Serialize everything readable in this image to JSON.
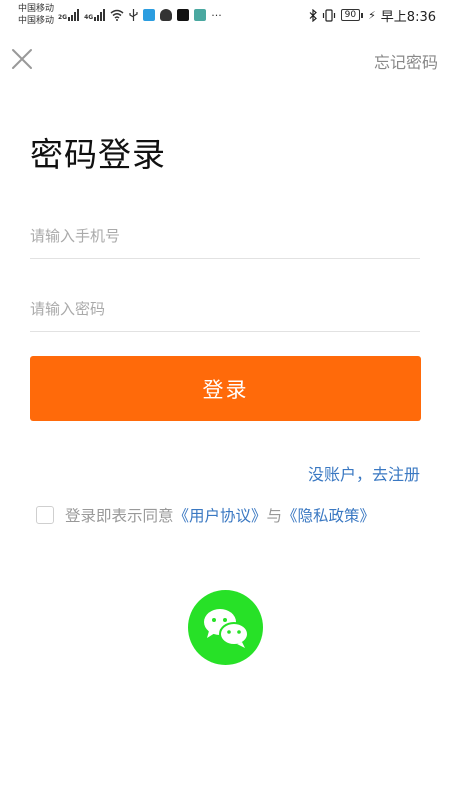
{
  "status_bar": {
    "carrier_1": "中国移动",
    "carrier_2": "中国移动",
    "net_1": "2G",
    "net_2": "4G",
    "battery": "90",
    "time": "早上8:36",
    "more": "···"
  },
  "header": {
    "forgot_password": "忘记密码"
  },
  "page": {
    "title": "密码登录"
  },
  "form": {
    "phone_placeholder": "请输入手机号",
    "password_placeholder": "请输入密码",
    "login_button": "登录"
  },
  "links": {
    "register": "没账户，去注册"
  },
  "agreement": {
    "prefix": "登录即表示同意",
    "user_agreement": "《用户协议》",
    "connector": "与",
    "privacy_policy": "《隐私政策》"
  },
  "colors": {
    "accent": "#ff6a0a",
    "link": "#3a78c2",
    "wechat": "#27e127"
  }
}
